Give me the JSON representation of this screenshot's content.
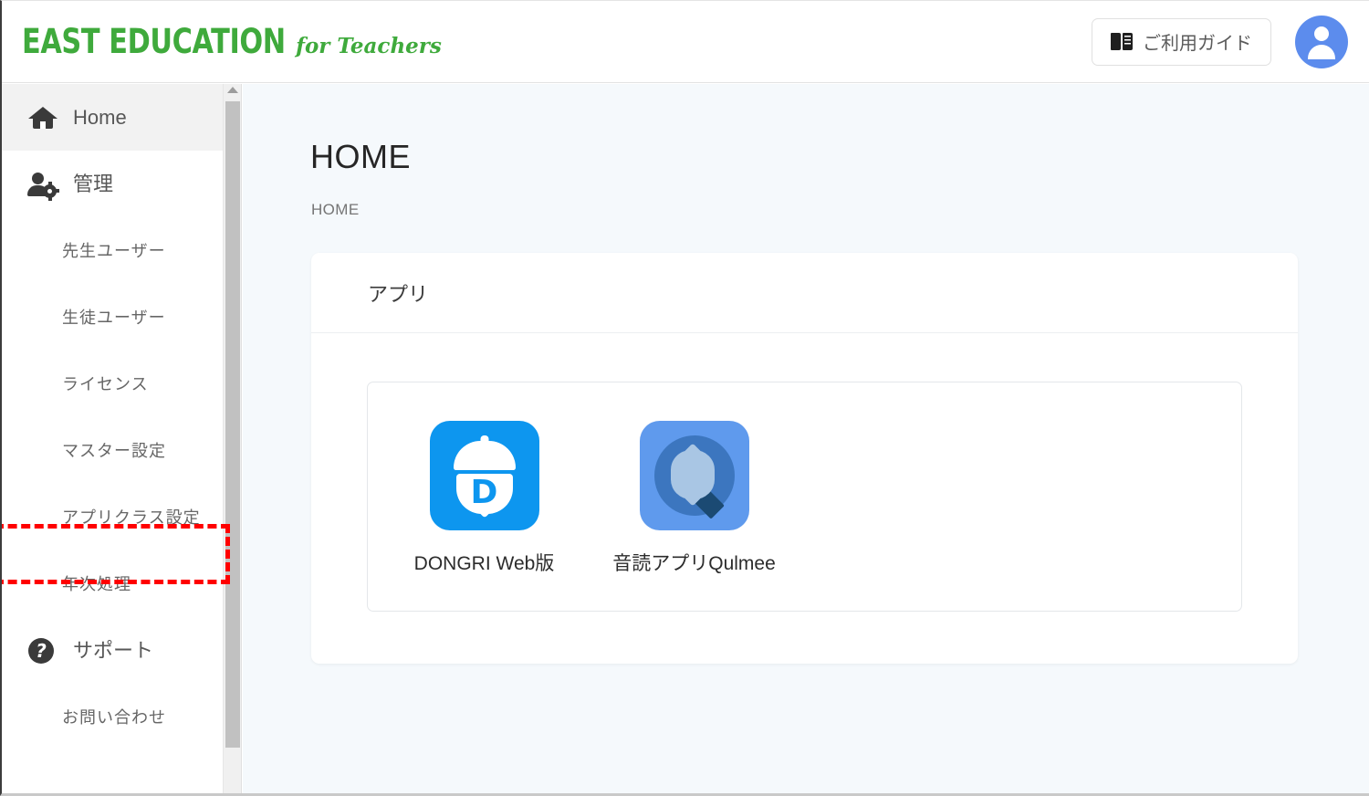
{
  "header": {
    "brand_main": "EAST EDUCATION",
    "brand_sub": "for Teachers",
    "guide_button_label": "ご利用ガイド",
    "guide_button_icon": "book-icon",
    "avatar_icon": "user-avatar-icon"
  },
  "sidebar": {
    "items": [
      {
        "label": "Home",
        "icon": "home-icon",
        "type": "top",
        "active": true
      },
      {
        "label": "管理",
        "icon": "manage-icon",
        "type": "top",
        "active": false
      },
      {
        "label": "先生ユーザー",
        "icon": "",
        "type": "sub",
        "active": false
      },
      {
        "label": "生徒ユーザー",
        "icon": "",
        "type": "sub",
        "active": false
      },
      {
        "label": "ライセンス",
        "icon": "",
        "type": "sub",
        "active": false
      },
      {
        "label": "マスター設定",
        "icon": "",
        "type": "sub",
        "active": false
      },
      {
        "label": "アプリクラス設定",
        "icon": "",
        "type": "sub",
        "active": false,
        "highlighted": true
      },
      {
        "label": "年次処理",
        "icon": "",
        "type": "sub",
        "active": false
      },
      {
        "label": "サポート",
        "icon": "support-icon",
        "type": "top",
        "active": false
      },
      {
        "label": "お問い合わせ",
        "icon": "",
        "type": "sub",
        "active": false
      }
    ],
    "scrollbar": {
      "up_arrow_icon": "chevron-up-icon"
    }
  },
  "main": {
    "page_title": "HOME",
    "breadcrumb": "HOME",
    "card": {
      "header_title": "アプリ",
      "apps": [
        {
          "label": "DONGRI Web版",
          "icon": "dongri-acorn-icon",
          "letter": "D"
        },
        {
          "label": "音読アプリQulmee",
          "icon": "qulmee-magnifier-icon"
        }
      ]
    }
  },
  "colors": {
    "brand_green": "#3faa3c",
    "page_background": "#f5f9fc",
    "sidebar_active": "#f2f2f2",
    "highlight_red": "#ff0000",
    "avatar_blue": "#5c8ced",
    "dongri_blue": "#0d96ef",
    "qulmee_blue": "#5f9aed"
  }
}
